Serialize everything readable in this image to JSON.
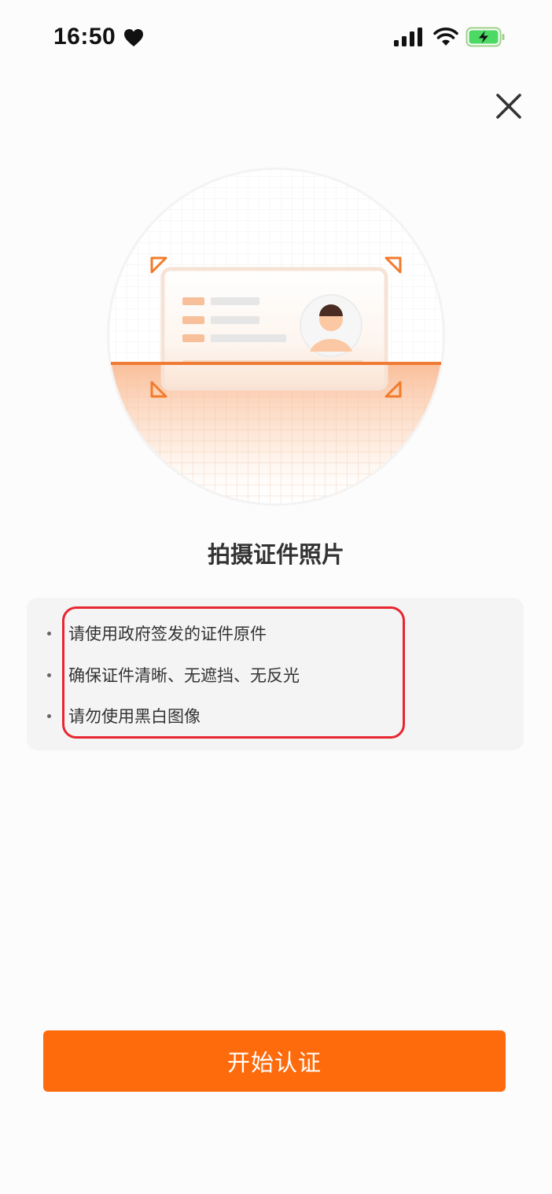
{
  "status_bar": {
    "time": "16:50",
    "icons": [
      "heart-icon",
      "signal-icon",
      "wifi-icon",
      "battery-charging-icon"
    ]
  },
  "header": {
    "close_icon": "close-icon"
  },
  "illustration": {
    "icon": "id-card-scan-illustration",
    "accent_color": "#f07a2e"
  },
  "content": {
    "title": "拍摄证件照片",
    "tips": [
      "请使用政府签发的证件原件",
      "确保证件清晰、无遮挡、无反光",
      "请勿使用黑白图像"
    ]
  },
  "actions": {
    "start_label": "开始认证",
    "button_color": "#fe6b0d"
  },
  "highlight": {
    "color": "#e8262f"
  }
}
